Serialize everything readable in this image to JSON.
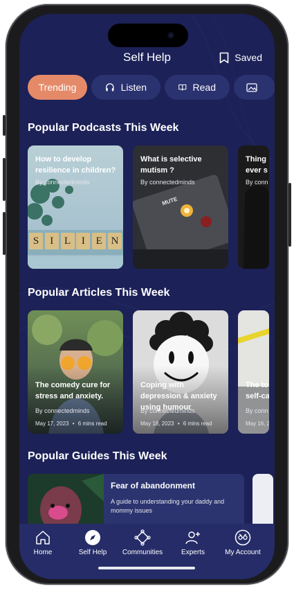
{
  "header": {
    "title": "Self Help",
    "saved_label": "Saved"
  },
  "tabs": [
    {
      "label": "Trending",
      "active": true
    },
    {
      "label": "Listen",
      "icon": "headphones-icon"
    },
    {
      "label": "Read",
      "icon": "book-icon"
    },
    {
      "label": "",
      "icon": "image-icon"
    }
  ],
  "podcasts": {
    "section_title": "Popular Podcasts This Week",
    "items": [
      {
        "title": "How to develop resilience in children?",
        "author": "By connectedminds",
        "tiles": [
          "S",
          "I",
          "L",
          "I",
          "E",
          "N"
        ]
      },
      {
        "title": "What is selective mutism ?",
        "author": "By connectedminds",
        "panel_label": "MUTE"
      },
      {
        "title": "Thing ever s",
        "author": "By conn"
      }
    ]
  },
  "articles": {
    "section_title": "Popular Articles This Week",
    "items": [
      {
        "title": "The comedy cure for stress and anxiety.",
        "author": "By connectedminds",
        "date": "May 17, 2023",
        "read_time": "6 mins read"
      },
      {
        "title": "Coping with depression & anxiety using humour",
        "author": "By connectedminds",
        "date": "May 18, 2023",
        "read_time": "6 mins read"
      },
      {
        "title": "The to self-car",
        "author": "By conn",
        "date": "May 16, 2"
      }
    ]
  },
  "guides": {
    "section_title": "Popular Guides This Week",
    "items": [
      {
        "title": "Fear of abandonment",
        "description": "A guide to understanding your daddy and mommy issues"
      }
    ]
  },
  "nav": [
    {
      "label": "Home",
      "icon": "home-icon"
    },
    {
      "label": "Self Help",
      "icon": "compass-icon",
      "active": true
    },
    {
      "label": "Communities",
      "icon": "communities-icon"
    },
    {
      "label": "Experts",
      "icon": "add-user-icon"
    },
    {
      "label": "My Account",
      "icon": "account-icon"
    }
  ],
  "colors": {
    "background": "#1c2157",
    "accent": "#e58a69",
    "nav_bg": "#252c68",
    "pill_bg": "#2b3270"
  }
}
